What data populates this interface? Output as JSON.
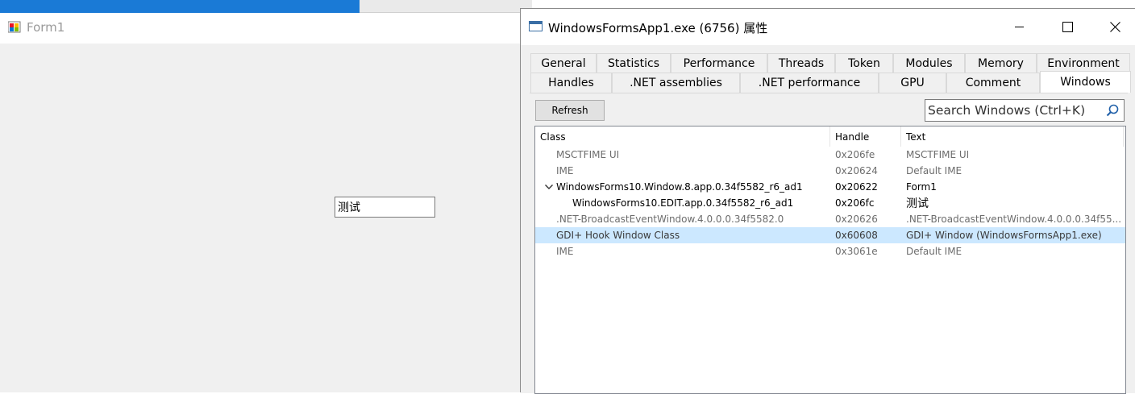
{
  "form1": {
    "title": "Form1",
    "textbox_value": "测试"
  },
  "props": {
    "title": "WindowsFormsApp1.exe (6756) 属性",
    "tabs_row1": [
      "General",
      "Statistics",
      "Performance",
      "Threads",
      "Token",
      "Modules",
      "Memory",
      "Environment"
    ],
    "tabs_row2": [
      "Handles",
      ".NET assemblies",
      ".NET performance",
      "GPU",
      "Comment",
      "Windows"
    ],
    "active_tab": "Windows",
    "refresh_label": "Refresh",
    "search_placeholder": "Search Windows (Ctrl+K)",
    "columns": [
      "Class",
      "Handle",
      "Text"
    ],
    "rows": [
      {
        "class": "MSCTFIME UI",
        "handle": "0x206fe",
        "text": "MSCTFIME UI",
        "style": "dim"
      },
      {
        "class": "IME",
        "handle": "0x20624",
        "text": "Default IME",
        "style": "dim"
      },
      {
        "class": "WindowsForms10.Window.8.app.0.34f5582_r6_ad1",
        "handle": "0x20622",
        "text": "Form1",
        "style": "normal"
      },
      {
        "class": "WindowsForms10.EDIT.app.0.34f5582_r6_ad1",
        "handle": "0x206fc",
        "text": "测试",
        "style": "normal"
      },
      {
        "class": ".NET-BroadcastEventWindow.4.0.0.0.34f5582.0",
        "handle": "0x20626",
        "text": ".NET-BroadcastEventWindow.4.0.0.0.34f55...",
        "style": "dim"
      },
      {
        "class": "GDI+ Hook Window Class",
        "handle": "0x60608",
        "text": "GDI+ Window (WindowsFormsApp1.exe)",
        "style": "dim"
      },
      {
        "class": "IME",
        "handle": "0x3061e",
        "text": "Default IME",
        "style": "dim"
      }
    ]
  },
  "colors": {
    "selection": "#cce8ff",
    "taskbar_blue": "#1a7ad6",
    "dim_text": "#6d6d6d"
  }
}
